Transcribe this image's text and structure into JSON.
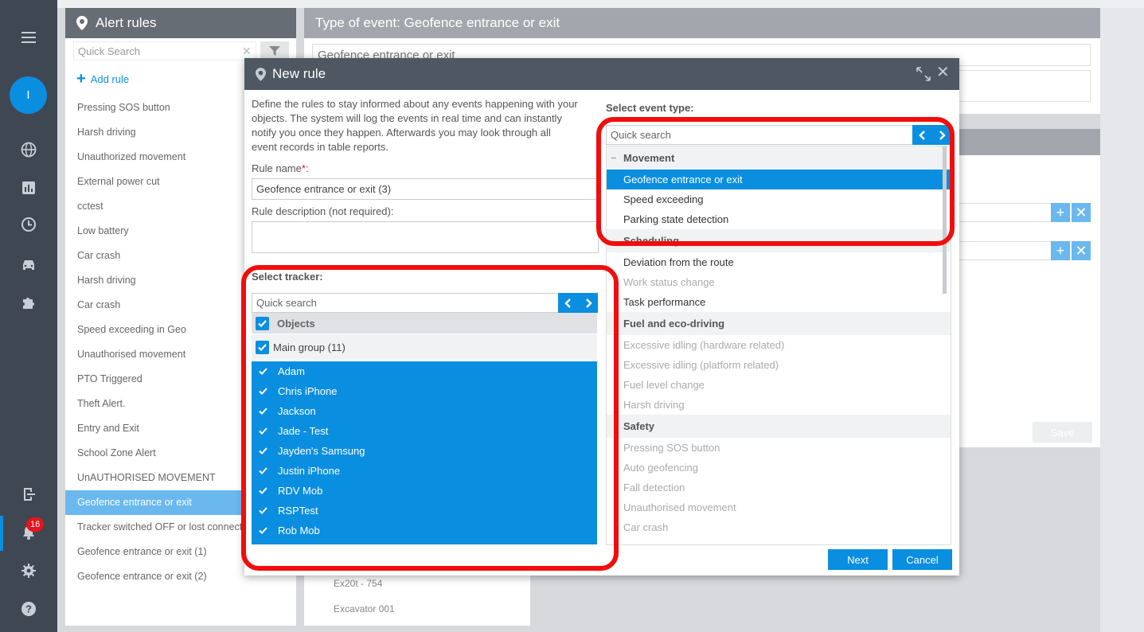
{
  "rail": {
    "avatar_initial": "I",
    "notifications_count": "16",
    "icons": [
      "menu-icon",
      "globe-icon",
      "chart-icon",
      "clock-icon",
      "car-icon",
      "puzzle-icon",
      "logout-icon",
      "bell-icon",
      "gear-icon",
      "help-icon"
    ]
  },
  "alert_rules": {
    "title": "Alert rules",
    "search_placeholder": "Quick Search",
    "add_label": "Add rule",
    "items": [
      "Pressing SOS button",
      "Harsh driving",
      "Unauthorized movement",
      "External power cut",
      "cctest",
      "Low battery",
      "Car crash",
      "Harsh driving",
      "Car crash",
      "Speed exceeding in Geo",
      "Unauthorised movement",
      "PTO Triggered",
      "Theft Alert.",
      "Entry and Exit",
      "School Zone Alert",
      "UnAUTHORISED MOVEMENT",
      "Geofence entrance or exit",
      "Tracker switched OFF or lost connection",
      "Geofence entrance or exit (1)",
      "Geofence entrance or exit (2)"
    ],
    "selected_index": 16
  },
  "type_panel": {
    "title": "Type of event: Geofence entrance or exit",
    "name_value": "Geofence entrance or exit"
  },
  "background": {
    "save_label": "Save",
    "tracker_items": [
      "Ex20t - 754",
      "Excavator 001"
    ]
  },
  "modal": {
    "title": "New rule",
    "intro": "Define the rules to stay informed about any events happening with your objects. The system will log the events in real time and can instantly notify you once they happen. Afterwards you may look through all event records in table reports.",
    "rule_name_label": "Rule name",
    "required_mark": "*",
    "colon": ":",
    "rule_name_value": "Geofence entrance or exit (3)",
    "rule_desc_label": "Rule description (not required):",
    "select_tracker_label": "Select tracker:",
    "tracker_search_placeholder": "Quick search",
    "objects_label": "Objects",
    "group_label": "Main group (11)",
    "trackers": [
      "Adam",
      "Chris iPhone",
      "Jackson",
      "Jade - Test",
      "Jayden's Samsung",
      "Justin iPhone",
      "RDV Mob",
      "RSPTest",
      "Rob Mob"
    ],
    "select_event_label": "Select event type:",
    "event_search_placeholder": "Quick search",
    "event_categories": [
      {
        "name": "Movement",
        "items": [
          {
            "label": "Geofence entrance or exit",
            "state": "selected"
          },
          {
            "label": "Speed exceeding",
            "state": "enabled"
          },
          {
            "label": "Parking state detection",
            "state": "enabled"
          }
        ]
      },
      {
        "name": "Scheduling",
        "items": [
          {
            "label": "Deviation from the route",
            "state": "enabled"
          },
          {
            "label": "Work status change",
            "state": "disabled"
          },
          {
            "label": "Task performance",
            "state": "enabled"
          }
        ]
      },
      {
        "name": "Fuel and eco-driving",
        "items": [
          {
            "label": "Excessive idling (hardware related)",
            "state": "disabled"
          },
          {
            "label": "Excessive idling (platform related)",
            "state": "disabled"
          },
          {
            "label": "Fuel level change",
            "state": "disabled"
          },
          {
            "label": "Harsh driving",
            "state": "disabled"
          }
        ]
      },
      {
        "name": "Safety",
        "items": [
          {
            "label": "Pressing SOS button",
            "state": "disabled"
          },
          {
            "label": "Auto geofencing",
            "state": "disabled"
          },
          {
            "label": "Fall detection",
            "state": "disabled"
          },
          {
            "label": "Unauthorised movement",
            "state": "disabled"
          },
          {
            "label": "Car crash",
            "state": "disabled"
          }
        ]
      }
    ],
    "next_label": "Next",
    "cancel_label": "Cancel"
  },
  "colors": {
    "accent": "#0a8ee0",
    "rail": "#3f4752",
    "annotation_red": "#f20d0d",
    "selected_rule": "#6ab8ee"
  }
}
